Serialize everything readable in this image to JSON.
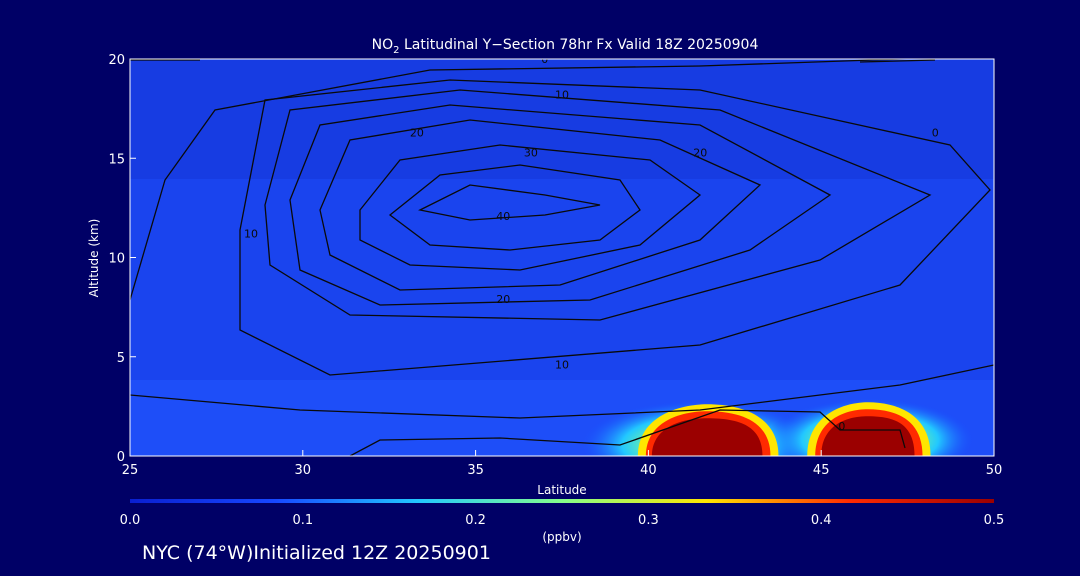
{
  "chart_data": {
    "type": "heatmap",
    "title_prefix": "NO",
    "title_subscript": "2",
    "title_rest": " Latitudinal Y−Section 78hr  Fx Valid 18Z 20250904",
    "xlabel": "Latitude",
    "ylabel": "Altitude (km)",
    "xlim": [
      25,
      50
    ],
    "ylim": [
      0,
      20
    ],
    "x_ticks": [
      "25",
      "30",
      "35",
      "40",
      "45",
      "50"
    ],
    "y_ticks": [
      "0",
      "5",
      "10",
      "15",
      "20"
    ],
    "colorbar": {
      "range": [
        0.0,
        0.5
      ],
      "ticks": [
        "0.0",
        "0.1",
        "0.2",
        "0.3",
        "0.4",
        "0.5"
      ],
      "unit": "(ppbv)",
      "colors": [
        "#0a1fcf",
        "#1747ff",
        "#22c8ff",
        "#86ff8a",
        "#ffe600",
        "#ff2a00",
        "#9b0000"
      ]
    },
    "high_regions": [
      {
        "lat_start": 40.1,
        "lat_end": 43.3,
        "alt_top": 1.9,
        "value": 0.5
      },
      {
        "lat_start": 45.0,
        "lat_end": 47.7,
        "alt_top": 2.0,
        "value": 0.5
      }
    ],
    "contour_labels": [
      {
        "text": "0",
        "lat": 37.0,
        "alt": 20.0
      },
      {
        "text": "10",
        "lat": 37.5,
        "alt": 18.2
      },
      {
        "text": "20",
        "lat": 33.3,
        "alt": 16.3
      },
      {
        "text": "30",
        "lat": 36.6,
        "alt": 15.3
      },
      {
        "text": "20",
        "lat": 41.5,
        "alt": 15.3
      },
      {
        "text": "40",
        "lat": 35.8,
        "alt": 12.1
      },
      {
        "text": "10",
        "lat": 28.5,
        "alt": 11.2
      },
      {
        "text": "20",
        "lat": 35.8,
        "alt": 7.9
      },
      {
        "text": "10",
        "lat": 37.5,
        "alt": 4.6
      },
      {
        "text": "0",
        "lat": 45.6,
        "alt": 1.5
      },
      {
        "text": "0",
        "lat": 48.3,
        "alt": 16.3
      }
    ]
  },
  "footer_text": "NYC (74°W)Initialized 12Z 20250901"
}
